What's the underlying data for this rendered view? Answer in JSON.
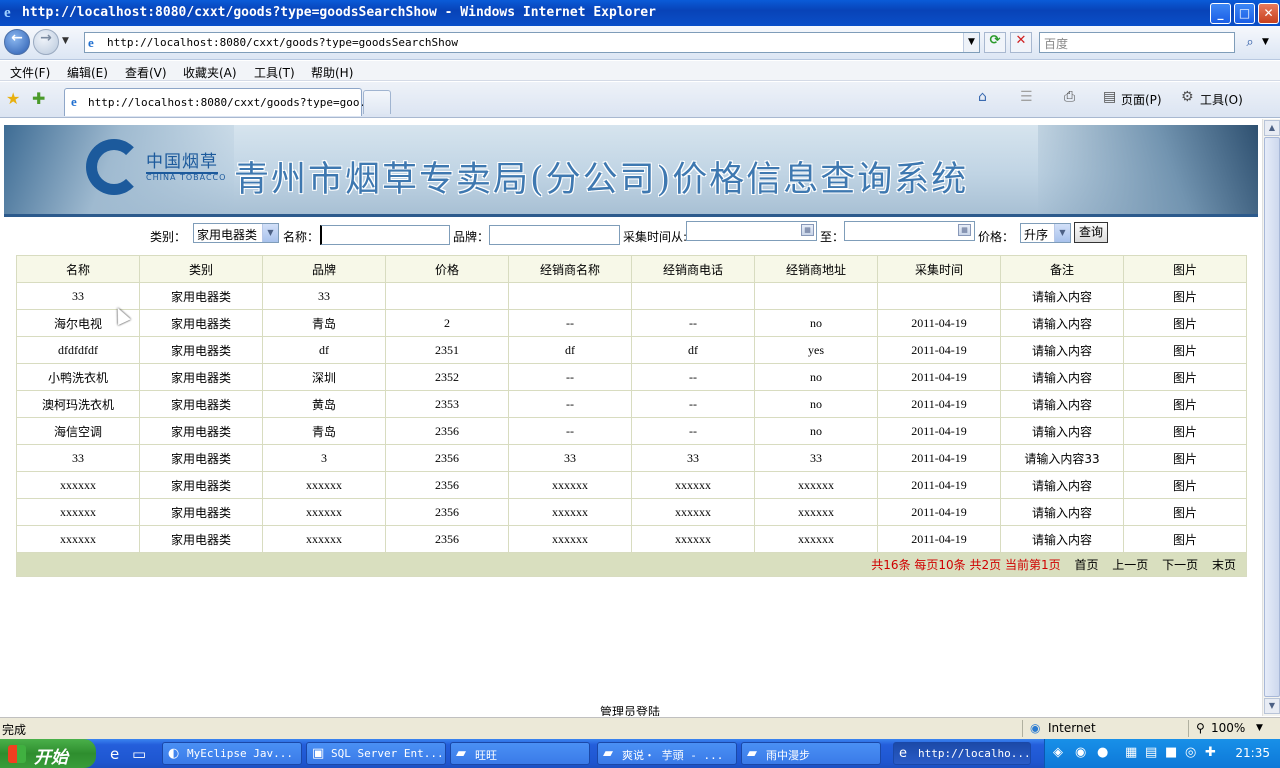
{
  "window": {
    "title": "http://localhost:8080/cxxt/goods?type=goodsSearchShow - Windows Internet Explorer",
    "minimize": "_",
    "maximize": "□",
    "close": "✕"
  },
  "address": {
    "url": "http://localhost:8080/cxxt/goods?type=goodsSearchShow",
    "search_placeholder": "百度"
  },
  "menu": [
    "文件(F)",
    "编辑(E)",
    "查看(V)",
    "收藏夹(A)",
    "工具(T)",
    "帮助(H)"
  ],
  "tab": {
    "label": "http://localhost:8080/cxxt/goods?type=goo..."
  },
  "commandbar": {
    "page": "页面(P)",
    "tools": "工具(O)"
  },
  "banner": {
    "logo_cn": "中国烟草",
    "logo_en": "CHINA TOBACCO",
    "title": "青州市烟草专卖局(分公司)价格信息查询系统"
  },
  "form": {
    "category_label": "类别：",
    "category_value": "家用电器类",
    "name_label": "名称：",
    "brand_label": "品牌：",
    "date_from_label": "采集时间从:",
    "date_to_label": "至：",
    "price_label": "价格：",
    "price_order_value": "升序",
    "query_button": "查询"
  },
  "table": {
    "headers": [
      "名称",
      "类别",
      "品牌",
      "价格",
      "经销商名称",
      "经销商电话",
      "经销商地址",
      "采集时间",
      "备注",
      "图片"
    ],
    "rows": [
      [
        "33",
        "家用电器类",
        "33",
        "",
        "",
        "",
        "",
        "",
        "请输入内容",
        "图片"
      ],
      [
        "海尔电视",
        "家用电器类",
        "青岛",
        "2",
        "--",
        "--",
        "no",
        "2011-04-19",
        "请输入内容",
        "图片"
      ],
      [
        "dfdfdfdf",
        "家用电器类",
        "df",
        "2351",
        "df",
        "df",
        "yes",
        "2011-04-19",
        "请输入内容",
        "图片"
      ],
      [
        "小鸭洗衣机",
        "家用电器类",
        "深圳",
        "2352",
        "--",
        "--",
        "no",
        "2011-04-19",
        "请输入内容",
        "图片"
      ],
      [
        "澳柯玛洗衣机",
        "家用电器类",
        "黄岛",
        "2353",
        "--",
        "--",
        "no",
        "2011-04-19",
        "请输入内容",
        "图片"
      ],
      [
        "海信空调",
        "家用电器类",
        "青岛",
        "2356",
        "--",
        "--",
        "no",
        "2011-04-19",
        "请输入内容",
        "图片"
      ],
      [
        "33",
        "家用电器类",
        "3",
        "2356",
        "33",
        "33",
        "33",
        "2011-04-19",
        "请输入内容33",
        "图片"
      ],
      [
        "xxxxxx",
        "家用电器类",
        "xxxxxx",
        "2356",
        "xxxxxx",
        "xxxxxx",
        "xxxxxx",
        "2011-04-19",
        "请输入内容",
        "图片"
      ],
      [
        "xxxxxx",
        "家用电器类",
        "xxxxxx",
        "2356",
        "xxxxxx",
        "xxxxxx",
        "xxxxxx",
        "2011-04-19",
        "请输入内容",
        "图片"
      ],
      [
        "xxxxxx",
        "家用电器类",
        "xxxxxx",
        "2356",
        "xxxxxx",
        "xxxxxx",
        "xxxxxx",
        "2011-04-19",
        "请输入内容",
        "图片"
      ]
    ]
  },
  "pager": {
    "total": "共16条",
    "per_page": "每页10条",
    "pages": "共2页",
    "current": "当前第1页",
    "first": "首页",
    "prev": "上一页",
    "next": "下一页",
    "last": "末页"
  },
  "footer": {
    "admin_login": "管理员登陆"
  },
  "status": {
    "text": "完成",
    "zone": "Internet",
    "zoom": "100%"
  },
  "taskbar": {
    "start": "开始",
    "tasks": [
      "MyEclipse Jav...",
      "SQL Server Ent...",
      "旺旺",
      "爽说・ 芋頭 - ...",
      "雨中漫步",
      "http://localho..."
    ],
    "clock": "21:35"
  },
  "colors": {
    "pager_highlight": "#d00000",
    "header_bg": "#f7f8e8",
    "pager_bg": "#d9dfbf"
  }
}
